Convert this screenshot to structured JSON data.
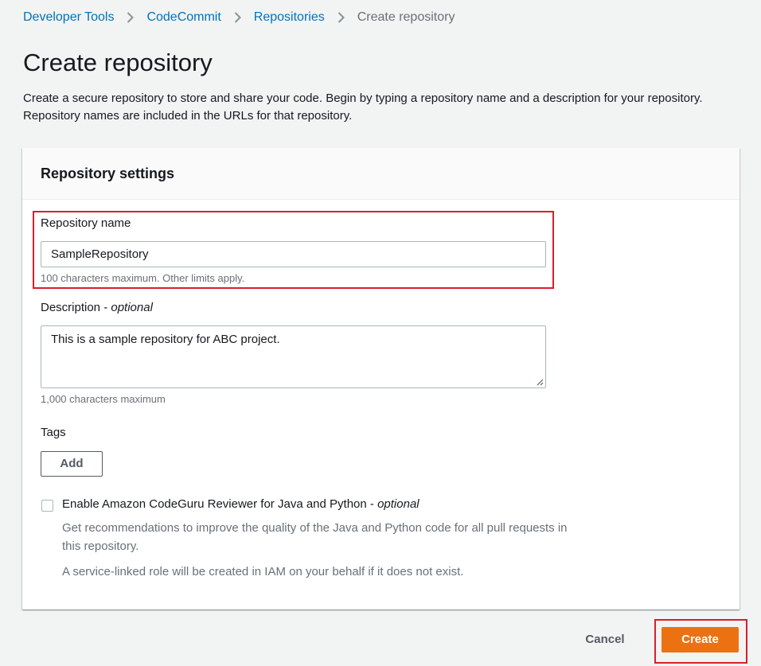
{
  "breadcrumb": {
    "items": [
      "Developer Tools",
      "CodeCommit",
      "Repositories"
    ],
    "current": "Create repository"
  },
  "page": {
    "title": "Create repository",
    "description": "Create a secure repository to store and share your code. Begin by typing a repository name and a description for your repository. Repository names are included in the URLs for that repository."
  },
  "settings": {
    "title": "Repository settings",
    "name": {
      "label": "Repository name",
      "value": "SampleRepository",
      "hint": "100 characters maximum. Other limits apply."
    },
    "description": {
      "label": "Description",
      "optional": "optional",
      "value": "This is a sample repository for ABC project.",
      "hint": "1,000 characters maximum"
    },
    "tags": {
      "label": "Tags",
      "add_label": "Add"
    },
    "codeguru": {
      "label": "Enable Amazon CodeGuru Reviewer for Java and Python",
      "optional": "optional",
      "checked": false,
      "description": "Get recommendations to improve the quality of the Java and Python code for all pull requests in this repository.",
      "note": "A service-linked role will be created in IAM on your behalf if it does not exist."
    }
  },
  "actions": {
    "cancel_label": "Cancel",
    "create_label": "Create"
  },
  "colors": {
    "link": "#0073bb",
    "primary": "#ec7211",
    "highlight": "#d91e2b",
    "background": "#f2f3f3"
  },
  "icons": {
    "separator": "chevron-right-icon",
    "resize": "resize-grip-icon"
  }
}
